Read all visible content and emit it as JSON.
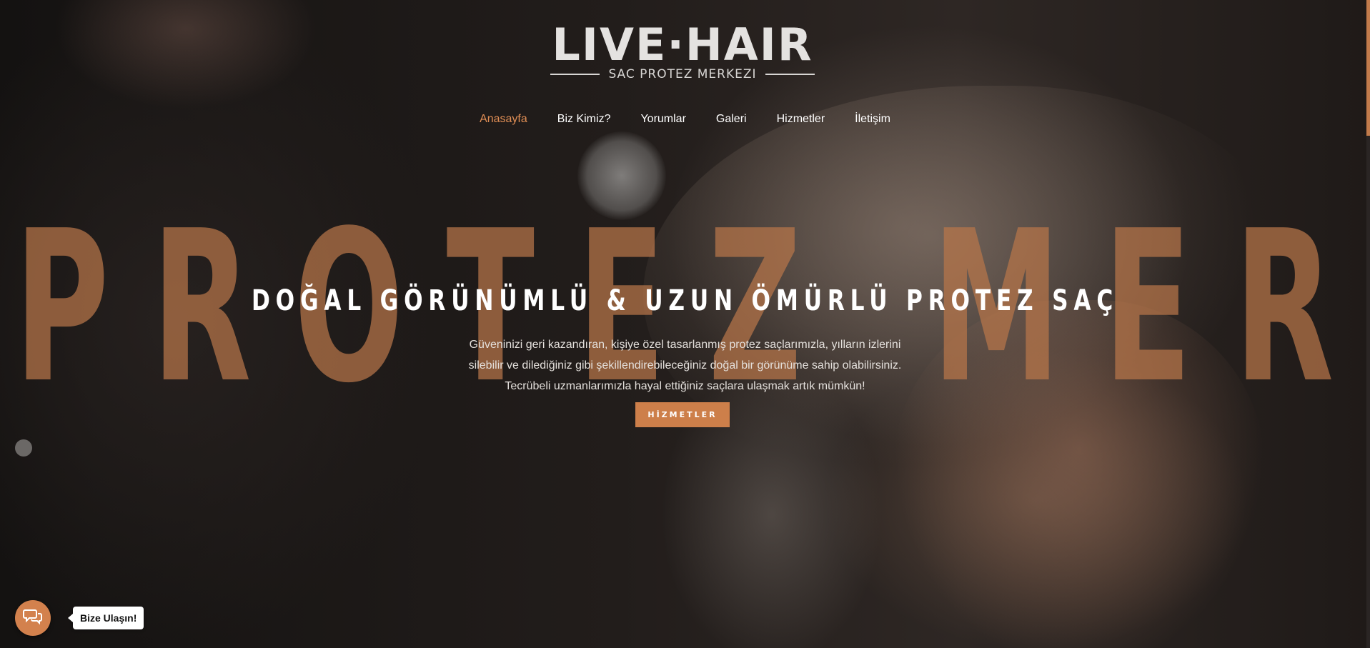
{
  "logo": {
    "main": "LIVE·HAIR",
    "sub": "SAC PROTEZ MERKEZI"
  },
  "nav": {
    "items": [
      {
        "label": "Anasayfa",
        "active": true
      },
      {
        "label": "Biz Kimiz?",
        "active": false
      },
      {
        "label": "Yorumlar",
        "active": false
      },
      {
        "label": "Galeri",
        "active": false
      },
      {
        "label": "Hizmetler",
        "active": false
      },
      {
        "label": "İletişim",
        "active": false
      }
    ]
  },
  "hero": {
    "background_word": "PROTEZ MERKEZ",
    "title": "DOĞAL GÖRÜNÜMLÜ & UZUN ÖMÜRLÜ PROTEZ SAÇ",
    "text_lines": [
      "Güveninizi geri kazandıran, kişiye özel tasarlanmış protez saçlarımızla, yılların izlerini",
      "silebilir ve dilediğiniz gibi şekillendirebileceğiniz doğal bir görünüme sahip olabilirsiniz.",
      "Tecrübeli uzmanlarımızla hayal ettiğiniz saçlara ulaşmak artık mümkün!"
    ],
    "button_label": "HİZMETLER"
  },
  "chat": {
    "icon": "chat-bubbles-icon",
    "label": "Bize Ulaşın!"
  },
  "colors": {
    "accent": "#cd7f4a",
    "nav_active": "#e08e55",
    "background_word": "#b8764a"
  }
}
